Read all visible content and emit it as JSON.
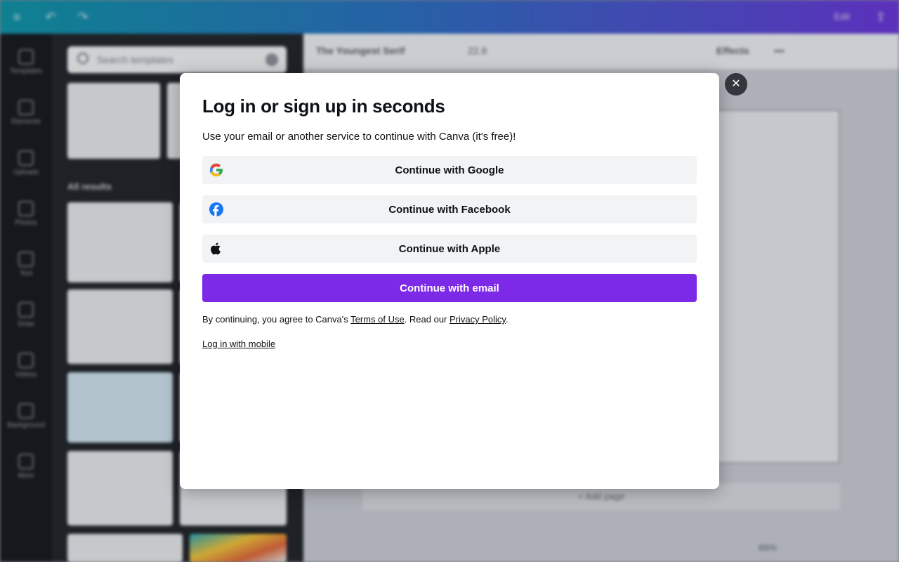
{
  "background": {
    "topbar": {
      "label": "Edit"
    },
    "rail": {
      "items": [
        {
          "label": "Templates"
        },
        {
          "label": "Elements"
        },
        {
          "label": "Uploads"
        },
        {
          "label": "Photos"
        },
        {
          "label": "Text"
        },
        {
          "label": "Draw"
        },
        {
          "label": "Videos"
        },
        {
          "label": "Background"
        },
        {
          "label": "More"
        }
      ]
    },
    "panel": {
      "search_placeholder": "Search templates",
      "results_label": "All results"
    },
    "toolbar": {
      "font": "The Youngest Serif",
      "size": "22.8",
      "effects": "Effects",
      "more": "•••"
    },
    "add_page": "+ Add page",
    "zoom": "66%"
  },
  "modal": {
    "close_symbol": "✕",
    "title": "Log in or sign up in seconds",
    "subtitle": "Use your email or another service to continue with Canva (it's free)!",
    "buttons": {
      "google": "Continue with Google",
      "facebook": "Continue with Facebook",
      "apple": "Continue with Apple",
      "email": "Continue with email"
    },
    "legal": {
      "prefix": "By continuing, you agree to Canva's ",
      "terms_link": "Terms of Use",
      "middle": ". Read our ",
      "privacy_link": "Privacy Policy",
      "suffix": "."
    },
    "mobile_link": "Log in with mobile"
  },
  "colors": {
    "brand_purple": "#7d2ae8",
    "facebook_blue": "#1877f2",
    "google_blue": "#4285f4",
    "google_red": "#ea4335",
    "google_yellow": "#fbbc05",
    "google_green": "#34a853"
  },
  "icons": [
    "google-icon",
    "facebook-icon",
    "apple-icon",
    "close-icon"
  ]
}
